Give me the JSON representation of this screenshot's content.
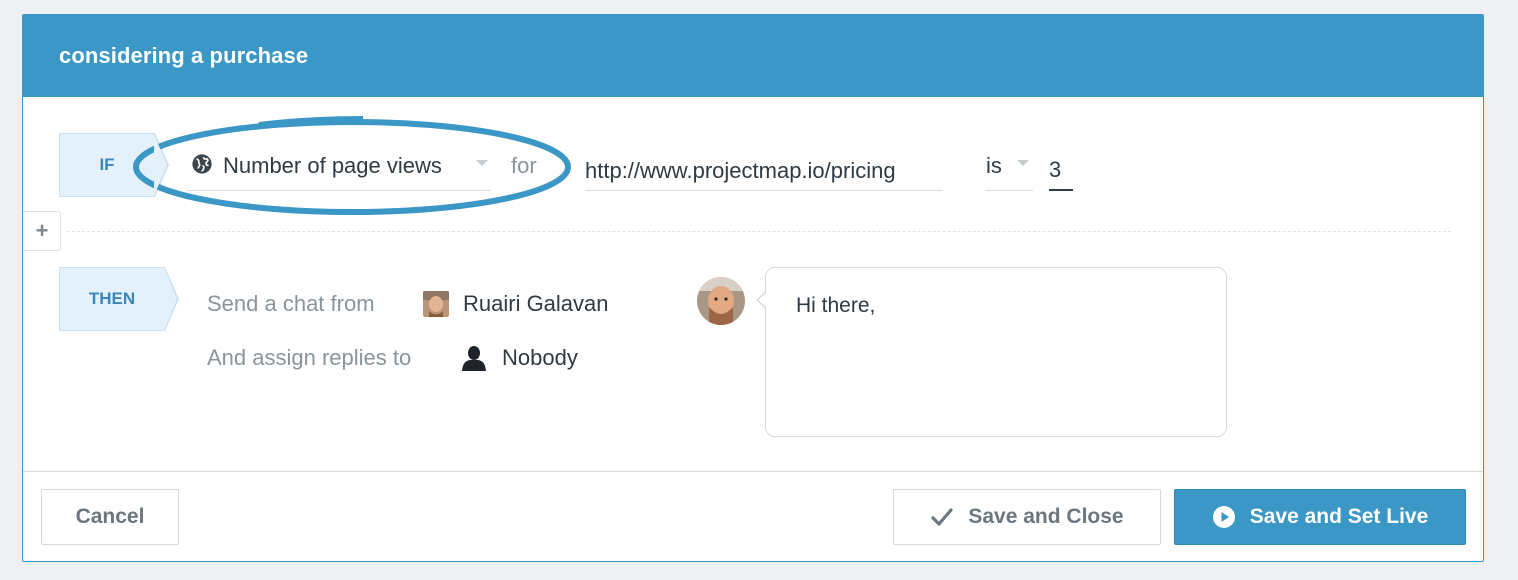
{
  "rule": {
    "title": "considering a purchase"
  },
  "condition": {
    "tag": "IF",
    "metric": "Number of page views",
    "metric_icon": "globe-icon",
    "connector": "for",
    "url": "http://www.projectmap.io/pricing",
    "operator": "is",
    "value": "3",
    "highlight_color": "#3a97c6"
  },
  "add_rule": {
    "label": "+"
  },
  "action": {
    "tag": "THEN",
    "send_label": "Send a chat from",
    "sender_name": "Ruairi Galavan",
    "assign_label": "And assign replies to",
    "assignee_name": "Nobody",
    "assignee_icon": "person-icon",
    "message": "Hi there,"
  },
  "footer": {
    "cancel_label": "Cancel",
    "save_close_label": "Save and Close",
    "save_close_icon": "checkmark-icon",
    "save_live_label": "Save and Set Live",
    "save_live_icon": "play-icon"
  },
  "colors": {
    "accent": "#3a97c6",
    "tag_background": "#e4f1fa"
  }
}
